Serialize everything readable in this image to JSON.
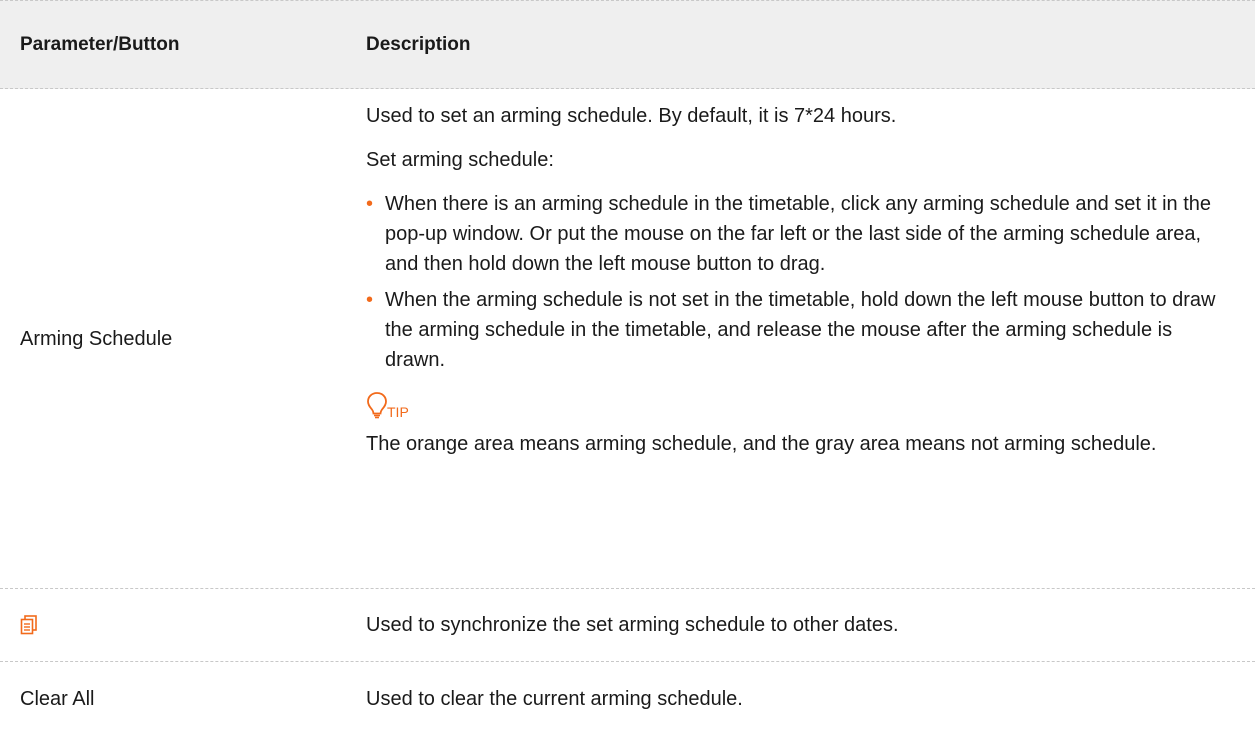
{
  "header": {
    "col1": "Parameter/Button",
    "col2": "Description"
  },
  "rows": {
    "arming": {
      "name": "Arming Schedule",
      "p1": "Used to set an arming schedule. By default, it is 7*24 hours.",
      "p2": "Set arming schedule:",
      "bullets": [
        "When there is an arming schedule in the timetable, click any arming schedule and set it in the pop-up window. Or put the mouse on the far left or the last side of the arming schedule area, and then hold down the left mouse button to drag.",
        "When the arming schedule is not set in the timetable, hold down the left mouse button to draw the arming schedule in the timetable, and release the mouse after the arming schedule is drawn."
      ],
      "tip_label": "TIP",
      "tip_text": "The orange area means arming schedule, and the gray area means not arming schedule."
    },
    "sync": {
      "icon": "copy-schedule-icon",
      "desc": "Used to synchronize the set arming schedule to other dates."
    },
    "clear": {
      "name": "Clear All",
      "desc": "Used to clear the current arming schedule."
    }
  },
  "colors": {
    "accent": "#f26a1b",
    "header_bg": "#efefef"
  }
}
